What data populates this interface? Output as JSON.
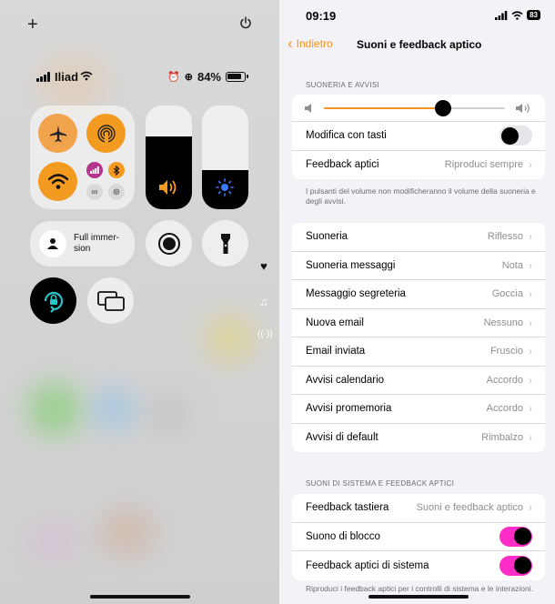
{
  "control_center": {
    "carrier": "Iliad",
    "battery_percent": "84%",
    "battery_level": 0.84,
    "focus_label": "Full immer- sion",
    "volume_level": 0.7,
    "brightness_level": 0.38,
    "icons": {
      "add": "plus-icon",
      "power": "power-icon",
      "airplane": "airplane-icon",
      "airdrop": "airdrop-icon",
      "wifi": "wifi-icon",
      "cellular": "cellular-icon",
      "bluetooth": "bluetooth-icon",
      "focus": "person-icon",
      "screen_record": "record-icon",
      "flashlight": "flashlight-icon",
      "rotation_lock": "rotation-lock-icon",
      "screen_mirroring": "screen-mirroring-icon",
      "heart": "heart-icon",
      "music": "music-note-icon",
      "connectivity": "antenna-icon"
    },
    "colors": {
      "accent": "#f39a20",
      "rotation_lock": "#29c3c9"
    }
  },
  "settings": {
    "status": {
      "time": "09:19",
      "battery": "83"
    },
    "nav": {
      "back_label": "Indietro",
      "title": "Suoni e feedback aptico"
    },
    "ringer_section": {
      "header": "SUONERIA E AVVISI",
      "volume_level": 0.66,
      "change_with_buttons_label": "Modifica con tasti",
      "change_with_buttons_on": false,
      "haptics_label": "Feedback aptici",
      "haptics_value": "Riproduci sempre",
      "footnote": "I pulsanti del volume non modificheranno il volume della suoneria e degli avvisi."
    },
    "sounds": [
      {
        "label": "Suoneria",
        "value": "Riflesso"
      },
      {
        "label": "Suoneria messaggi",
        "value": "Nota"
      },
      {
        "label": "Messaggio segreteria",
        "value": "Goccia"
      },
      {
        "label": "Nuova email",
        "value": "Nessuno"
      },
      {
        "label": "Email inviata",
        "value": "Fruscio"
      },
      {
        "label": "Avvisi calendario",
        "value": "Accordo"
      },
      {
        "label": "Avvisi promemoria",
        "value": "Accordo"
      },
      {
        "label": "Avvisi di default",
        "value": "Rimbalzo"
      }
    ],
    "system_section": {
      "header": "SUONI DI SISTEMA E FEEDBACK APTICI",
      "keyboard_label": "Feedback tastiera",
      "keyboard_value": "Suoni e feedback aptico",
      "lock_sound_label": "Suono di blocco",
      "lock_sound_on": true,
      "system_haptics_label": "Feedback aptici di sistema",
      "system_haptics_on": true,
      "footnote": "Riproduci i feedback aptici per i controlli di sistema e le interazioni."
    },
    "colors": {
      "accent": "#f7931e",
      "toggle_on": "#ff2dc8"
    }
  }
}
